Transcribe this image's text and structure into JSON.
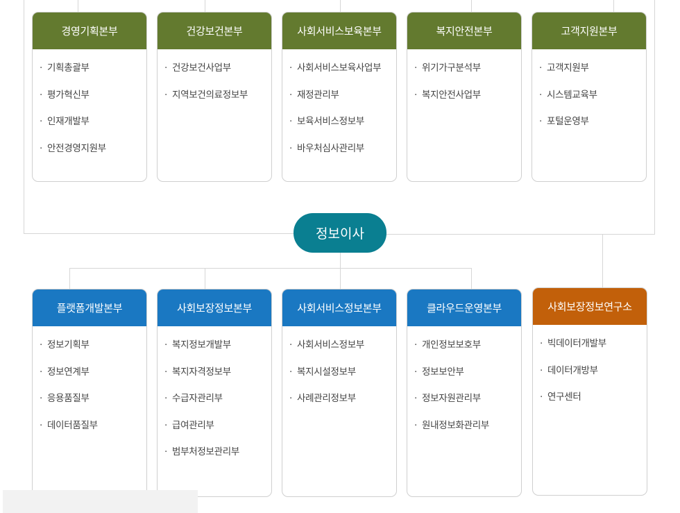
{
  "top_row": [
    {
      "title": "경영기획본부",
      "items": [
        "기획총괄부",
        "평가혁신부",
        "인재개발부",
        "안전경영지원부"
      ]
    },
    {
      "title": "건강보건본부",
      "items": [
        "건강보건사업부",
        "지역보건의료정보부"
      ]
    },
    {
      "title": "사회서비스보육본부",
      "items": [
        "사회서비스보육사업부",
        "재정관리부",
        "보육서비스정보부",
        "바우처심사관리부"
      ]
    },
    {
      "title": "복지안전본부",
      "items": [
        "위기가구분석부",
        "복지안전사업부"
      ]
    },
    {
      "title": "고객지원본부",
      "items": [
        "고객지원부",
        "시스템교육부",
        "포털운영부"
      ]
    }
  ],
  "center_node": {
    "label": "정보이사"
  },
  "bottom_row": [
    {
      "title": "플랫폼개발본부",
      "items": [
        "정보기획부",
        "정보연계부",
        "응용품질부",
        "데이터품질부"
      ]
    },
    {
      "title": "사회보장정보본부",
      "items": [
        "복지정보개발부",
        "복지자격정보부",
        "수급자관리부",
        "급여관리부",
        "범부처정보관리부"
      ]
    },
    {
      "title": "사회서비스정보본부",
      "items": [
        "사회서비스정보부",
        "복지시설정보부",
        "사례관리정보부"
      ]
    },
    {
      "title": "클라우드운영본부",
      "items": [
        "개인정보보호부",
        "정보보안부",
        "정보자원관리부",
        "원내정보화관리부"
      ]
    }
  ],
  "institute": {
    "title": "사회보장정보연구소",
    "items": [
      "빅데이터개발부",
      "데이터개방부",
      "연구센터"
    ]
  },
  "colors": {
    "top_header": "#637a2f",
    "bottom_header": "#1a78c2",
    "institute_header": "#c2600a",
    "center_node": "#0a7f91",
    "connector": "#d6d6d6"
  }
}
